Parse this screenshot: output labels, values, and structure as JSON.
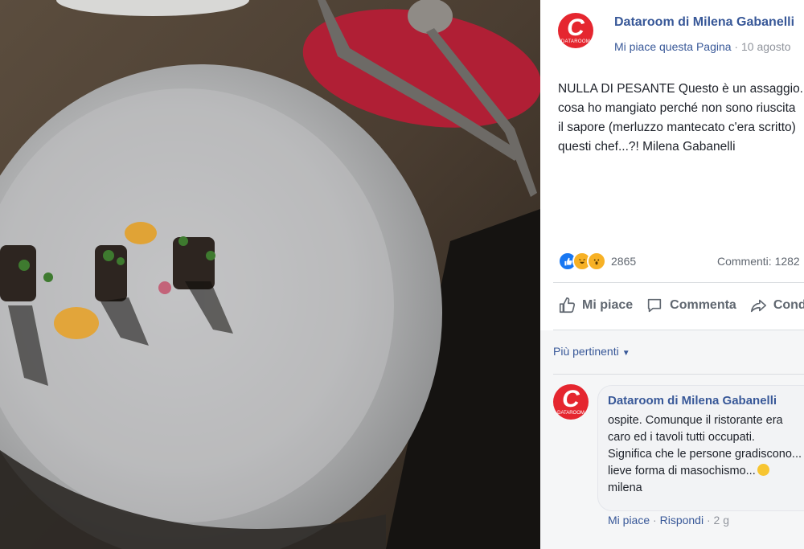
{
  "post": {
    "page_name": "Dataroom di Milena Gabanelli",
    "logo_letter": "C",
    "logo_subtext": "DATAROOM",
    "meta": {
      "like_page": "Mi piace questa Pagina",
      "separator": " · ",
      "date": "10 agosto"
    },
    "text_lines": [
      "NULLA DI PESANTE Questo è un assaggio...",
      "cosa ho mangiato perché non sono riuscita",
      "il sapore (merluzzo mantecato c'era scritto)",
      "questi chef...?! Milena Gabanelli"
    ],
    "reactions_count": "2865",
    "comments_count": "Commenti: 1282",
    "actions": {
      "like": "Mi piace",
      "comment": "Commenta",
      "share": "Condividi"
    }
  },
  "comments": {
    "sort_label": "Più pertinenti",
    "items": [
      {
        "author": "Dataroom di Milena Gabanelli",
        "lines": [
          "ospite. Comunque il ristorante era",
          "caro ed i tavoli tutti occupati.",
          "Significa che le persone gradiscono...",
          "lieve forma di masochismo..."
        ],
        "signature": "milena",
        "like_label": "Mi piace",
        "reply_label": "Rispondi",
        "time": "2 g"
      }
    ]
  },
  "colors": {
    "brand_red": "#e5262f",
    "link_blue": "#385898",
    "text": "#1d2129",
    "muted": "#90949c"
  }
}
